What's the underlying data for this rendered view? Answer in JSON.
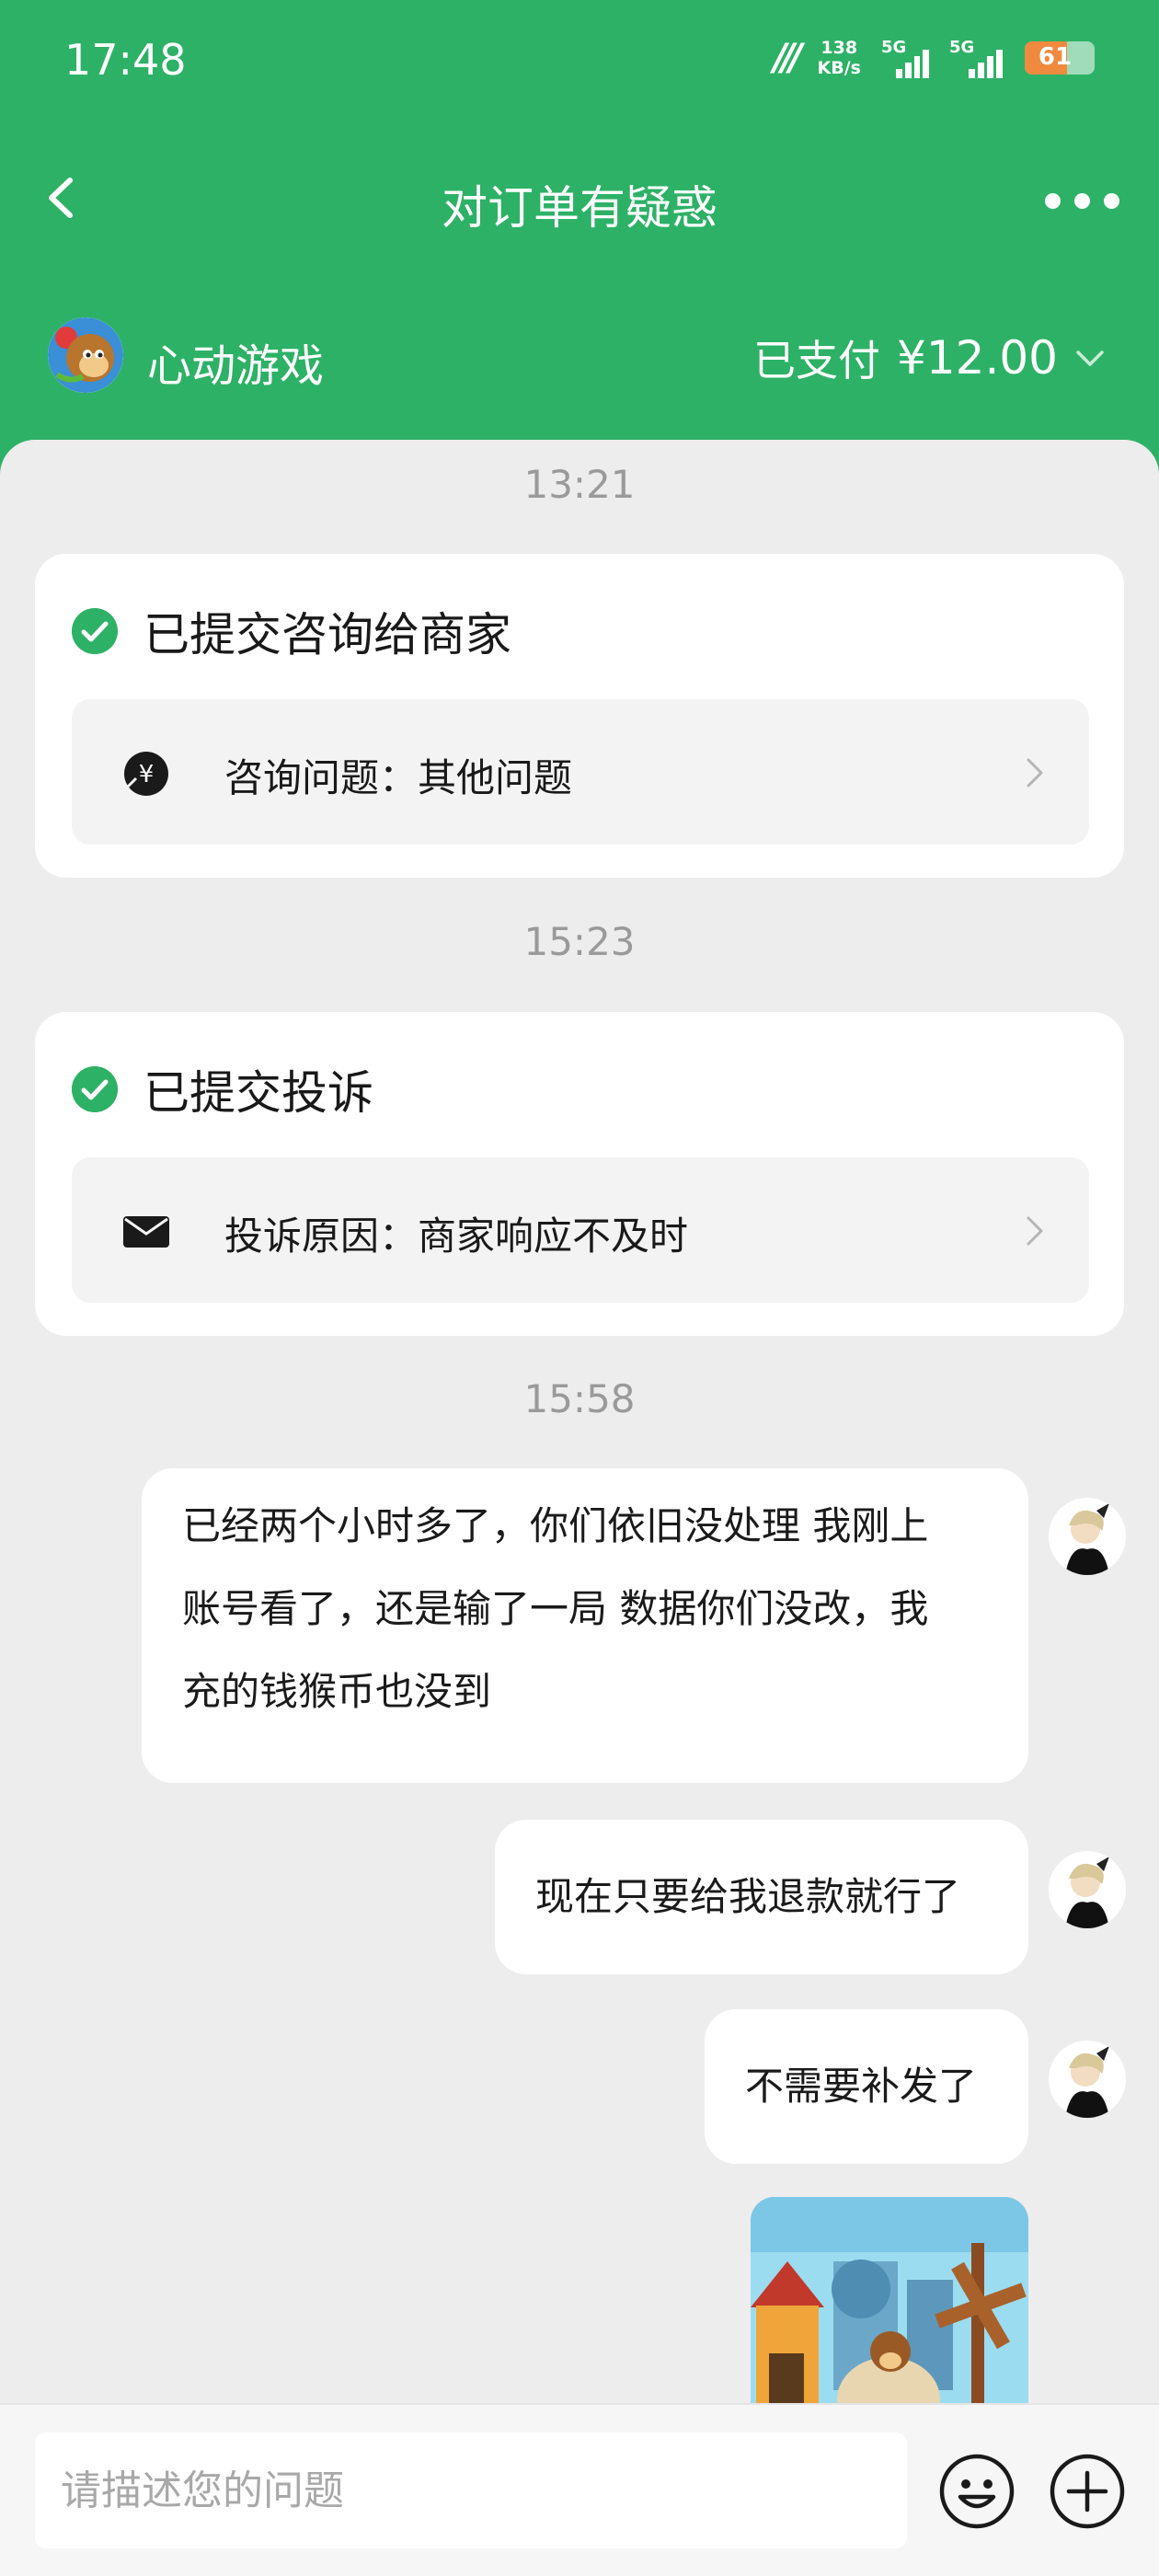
{
  "status": {
    "time": "17:48",
    "speed_value": "138",
    "speed_unit": "KB/s",
    "sim1": "5G",
    "sim2": "5G",
    "battery": "61",
    "battery_level": 0.61
  },
  "nav": {
    "title": "对订单有疑惑"
  },
  "merchant": {
    "name": "心动游戏",
    "paid_label": "已支付",
    "paid_amount": "¥12.00"
  },
  "timeline": {
    "ts1": "13:21",
    "card1": {
      "title": "已提交咨询给商家",
      "row_text": "咨询问题：其他问题"
    },
    "ts2": "15:23",
    "card2": {
      "title": "已提交投诉",
      "row_text": "投诉原因：商家响应不及时"
    },
    "ts3": "15:58"
  },
  "messages": {
    "m1_l1": "已经两个小时多了，你们依旧没处理 我刚上",
    "m1_l2": "账号看了，还是输了一局 数据你们没改，我",
    "m1_l3": "充的钱猴币也没到",
    "m2": "现在只要给我退款就行了",
    "m3": "不需要补发了"
  },
  "input": {
    "placeholder": "请描述您的问题"
  },
  "icons": {
    "back": "back-arrow-icon",
    "more": "more-dots-icon",
    "expand": "chevron-down-icon",
    "check": "check-circle-icon",
    "yen": "yen-coin-icon",
    "mail": "envelope-icon",
    "emoji": "emoji-icon",
    "plus": "plus-circle-icon"
  },
  "colors": {
    "brand_green": "#2db166",
    "background": "#ededed"
  }
}
